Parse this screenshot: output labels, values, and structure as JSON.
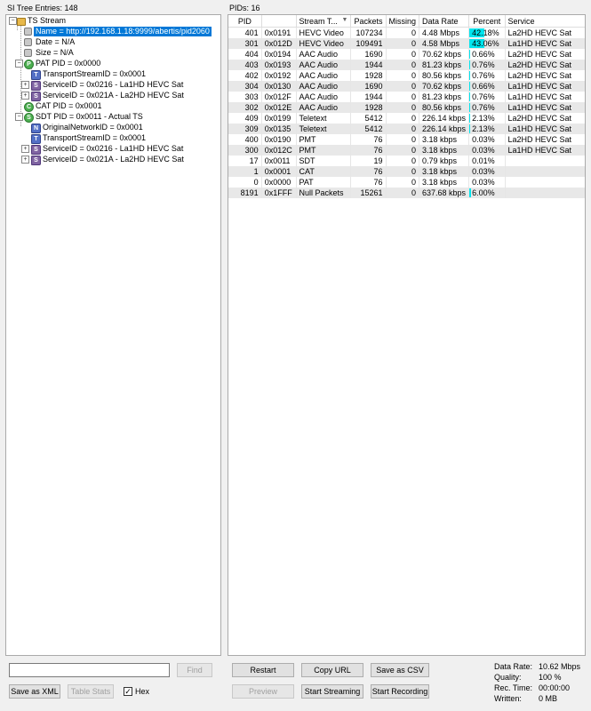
{
  "tree_panel": {
    "title": "SI Tree Entries: 148",
    "nodes": [
      {
        "text": "TS Stream"
      },
      {
        "text": "Name = http://192.168.1.18:9999/abertis/pid2060"
      },
      {
        "text": "Date = N/A"
      },
      {
        "text": "Size = N/A"
      },
      {
        "text": "PAT PID = 0x0000"
      },
      {
        "text": "TransportStreamID = 0x0001"
      },
      {
        "text": "ServiceID = 0x0216 - La1HD HEVC Sat"
      },
      {
        "text": "ServiceID = 0x021A - La2HD HEVC Sat"
      },
      {
        "text": "CAT PID = 0x0001"
      },
      {
        "text": "SDT PID = 0x0011 - Actual TS"
      },
      {
        "text": "OriginalNetworkID = 0x0001"
      },
      {
        "text": "TransportStreamID = 0x0001"
      },
      {
        "text": "ServiceID = 0x0216 - La1HD HEVC Sat"
      },
      {
        "text": "ServiceID = 0x021A - La2HD HEVC Sat"
      }
    ],
    "icons": {
      "p": "P",
      "c": "C",
      "s": "S",
      "t": "T",
      "n": "N"
    },
    "find_label": "Find",
    "save_xml_label": "Save as XML",
    "table_stats_label": "Table Stats",
    "hex_label": "Hex",
    "hex_checked": "✓"
  },
  "pid_panel": {
    "title": "PIDs: 16",
    "columns": [
      "PID",
      "",
      "Stream T...",
      "Packets",
      "Missing",
      "Data Rate",
      "Percent",
      "Service"
    ],
    "sort_indicator": "▼",
    "rows": [
      {
        "pid": "401",
        "hex": "0x0191",
        "type": "HEVC Video",
        "packets": "107234",
        "missing": "0",
        "rate": "4.48 Mbps",
        "percent": "42.18%",
        "pct": 42.18,
        "service": "La2HD HEVC Sat"
      },
      {
        "pid": "301",
        "hex": "0x012D",
        "type": "HEVC Video",
        "packets": "109491",
        "missing": "0",
        "rate": "4.58 Mbps",
        "percent": "43.06%",
        "pct": 43.06,
        "service": "La1HD HEVC Sat"
      },
      {
        "pid": "404",
        "hex": "0x0194",
        "type": "AAC Audio",
        "packets": "1690",
        "missing": "0",
        "rate": "70.62 kbps",
        "percent": "0.66%",
        "pct": 0.66,
        "service": "La2HD HEVC Sat"
      },
      {
        "pid": "403",
        "hex": "0x0193",
        "type": "AAC Audio",
        "packets": "1944",
        "missing": "0",
        "rate": "81.23 kbps",
        "percent": "0.76%",
        "pct": 0.76,
        "service": "La2HD HEVC Sat"
      },
      {
        "pid": "402",
        "hex": "0x0192",
        "type": "AAC Audio",
        "packets": "1928",
        "missing": "0",
        "rate": "80.56 kbps",
        "percent": "0.76%",
        "pct": 0.76,
        "service": "La2HD HEVC Sat"
      },
      {
        "pid": "304",
        "hex": "0x0130",
        "type": "AAC Audio",
        "packets": "1690",
        "missing": "0",
        "rate": "70.62 kbps",
        "percent": "0.66%",
        "pct": 0.66,
        "service": "La1HD HEVC Sat"
      },
      {
        "pid": "303",
        "hex": "0x012F",
        "type": "AAC Audio",
        "packets": "1944",
        "missing": "0",
        "rate": "81.23 kbps",
        "percent": "0.76%",
        "pct": 0.76,
        "service": "La1HD HEVC Sat"
      },
      {
        "pid": "302",
        "hex": "0x012E",
        "type": "AAC Audio",
        "packets": "1928",
        "missing": "0",
        "rate": "80.56 kbps",
        "percent": "0.76%",
        "pct": 0.76,
        "service": "La1HD HEVC Sat"
      },
      {
        "pid": "409",
        "hex": "0x0199",
        "type": "Teletext",
        "packets": "5412",
        "missing": "0",
        "rate": "226.14 kbps",
        "percent": "2.13%",
        "pct": 2.13,
        "service": "La2HD HEVC Sat"
      },
      {
        "pid": "309",
        "hex": "0x0135",
        "type": "Teletext",
        "packets": "5412",
        "missing": "0",
        "rate": "226.14 kbps",
        "percent": "2.13%",
        "pct": 2.13,
        "service": "La1HD HEVC Sat"
      },
      {
        "pid": "400",
        "hex": "0x0190",
        "type": "PMT",
        "packets": "76",
        "missing": "0",
        "rate": "3.18 kbps",
        "percent": "0.03%",
        "pct": 0.03,
        "service": "La2HD HEVC Sat"
      },
      {
        "pid": "300",
        "hex": "0x012C",
        "type": "PMT",
        "packets": "76",
        "missing": "0",
        "rate": "3.18 kbps",
        "percent": "0.03%",
        "pct": 0.03,
        "service": "La1HD HEVC Sat"
      },
      {
        "pid": "17",
        "hex": "0x0011",
        "type": "SDT",
        "packets": "19",
        "missing": "0",
        "rate": "0.79 kbps",
        "percent": "0.01%",
        "pct": 0.01,
        "service": ""
      },
      {
        "pid": "1",
        "hex": "0x0001",
        "type": "CAT",
        "packets": "76",
        "missing": "0",
        "rate": "3.18 kbps",
        "percent": "0.03%",
        "pct": 0.03,
        "service": ""
      },
      {
        "pid": "0",
        "hex": "0x0000",
        "type": "PAT",
        "packets": "76",
        "missing": "0",
        "rate": "3.18 kbps",
        "percent": "0.03%",
        "pct": 0.03,
        "service": ""
      },
      {
        "pid": "8191",
        "hex": "0x1FFF",
        "type": "Null Packets",
        "packets": "15261",
        "missing": "0",
        "rate": "637.68 kbps",
        "percent": "6.00%",
        "pct": 6.0,
        "service": ""
      }
    ]
  },
  "controls": {
    "restart": "Restart",
    "copy_url": "Copy URL",
    "save_csv": "Save as CSV",
    "preview": "Preview",
    "start_streaming": "Start Streaming",
    "start_recording": "Start Recording"
  },
  "stats": {
    "data_rate_label": "Data Rate:",
    "data_rate": "10.62 Mbps",
    "quality_label": "Quality:",
    "quality": "100 %",
    "rec_time_label": "Rec. Time:",
    "rec_time": "00:00:00",
    "written_label": "Written:",
    "written": "0 MB"
  },
  "colors": {
    "selection": "#0078d7",
    "percent_bar": "#00e5ee"
  }
}
